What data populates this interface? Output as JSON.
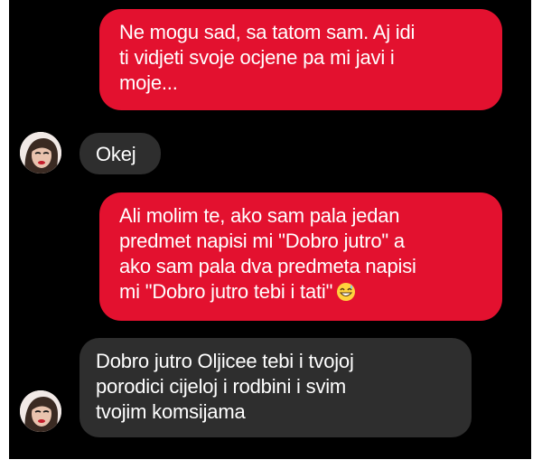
{
  "messages": [
    {
      "sender": "me",
      "lines": [
        "Ne mogu sad, sa tatom sam. Aj idi",
        "ti vidjeti svoje ocjene pa mi javi i",
        "moje..."
      ]
    },
    {
      "sender": "contact",
      "lines": [
        "Okej"
      ]
    },
    {
      "sender": "me",
      "lines": [
        "Ali molim te, ako sam pala jedan",
        "predmet napisi mi \"Dobro jutro\" a",
        "ako sam pala dva predmeta napisi",
        "mi \"Dobro jutro tebi i tati\""
      ],
      "emoji": "grinning-sweat-emoji"
    },
    {
      "sender": "contact",
      "lines": [
        "Dobro jutro Oljicee tebi i tvojoj",
        "porodici cijeloj i rodbini i svim",
        "tvojim komsijama"
      ]
    }
  ],
  "colors": {
    "background": "#000000",
    "sent_bubble": "#e3112f",
    "received_bubble": "#2e2e2e",
    "text": "#ffffff"
  }
}
